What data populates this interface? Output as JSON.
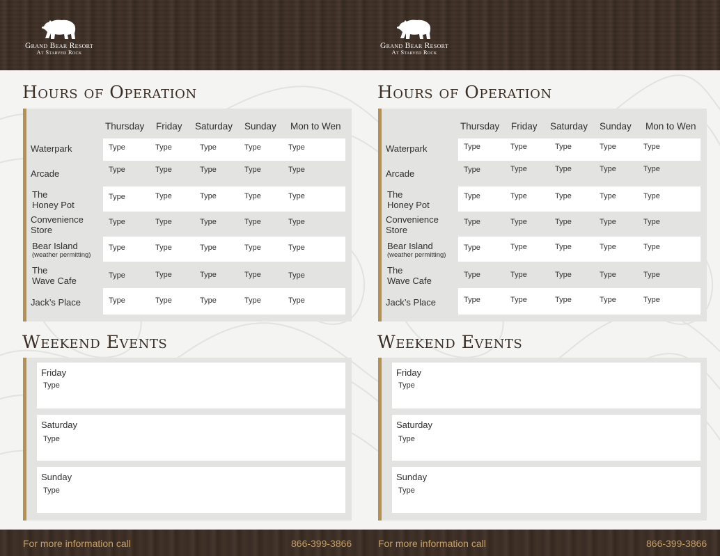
{
  "brand": {
    "name": "Grand Bear Resort",
    "subtitle": "At Starved Rock"
  },
  "hours": {
    "title": "Hours of Operation",
    "columns": [
      "Thursday",
      "Friday",
      "Saturday",
      "Sunday",
      "Mon to Wen"
    ],
    "rows": [
      {
        "label_lines": [
          "Waterpark"
        ],
        "note": "",
        "cells": [
          "Type",
          "Type",
          "Type",
          "Type",
          "Type"
        ]
      },
      {
        "label_lines": [
          "Arcade"
        ],
        "note": "",
        "cells": [
          "Type",
          "Type",
          "Type",
          "Type",
          "Type"
        ]
      },
      {
        "label_lines": [
          "The",
          "Honey Pot"
        ],
        "note": "",
        "cells": [
          "Type",
          "Type",
          "Type",
          "Type",
          "Type"
        ]
      },
      {
        "label_lines": [
          "Convenience",
          "Store"
        ],
        "note": "",
        "cells": [
          "Type",
          "Type",
          "Type",
          "Type",
          "Type"
        ]
      },
      {
        "label_lines": [
          "Bear Island"
        ],
        "note": "(weather permitting)",
        "cells": [
          "Type",
          "Type",
          "Type",
          "Type",
          "Type"
        ]
      },
      {
        "label_lines": [
          "The",
          "Wave Cafe"
        ],
        "note": "",
        "cells": [
          "Type",
          "Type",
          "Type",
          "Type",
          "Type"
        ]
      },
      {
        "label_lines": [
          "Jack’s Place"
        ],
        "note": "",
        "cells": [
          "Type",
          "Type",
          "Type",
          "Type",
          "Type"
        ]
      }
    ]
  },
  "events": {
    "title": "Weekend Events",
    "items": [
      {
        "day": "Friday",
        "text": "Type"
      },
      {
        "day": "Saturday",
        "text": "Type"
      },
      {
        "day": "Sunday",
        "text": "Type"
      }
    ]
  },
  "footer": {
    "info_text": "For more information call",
    "phone": "866-399-3866"
  },
  "colors": {
    "wood": "#3a2d25",
    "accent_gold": "#b7904f",
    "footer_text": "#c9a063",
    "title_brown": "#3b2e25",
    "panel_gray": "#e3e3e2"
  },
  "icons": {
    "logo": "bear-icon"
  }
}
